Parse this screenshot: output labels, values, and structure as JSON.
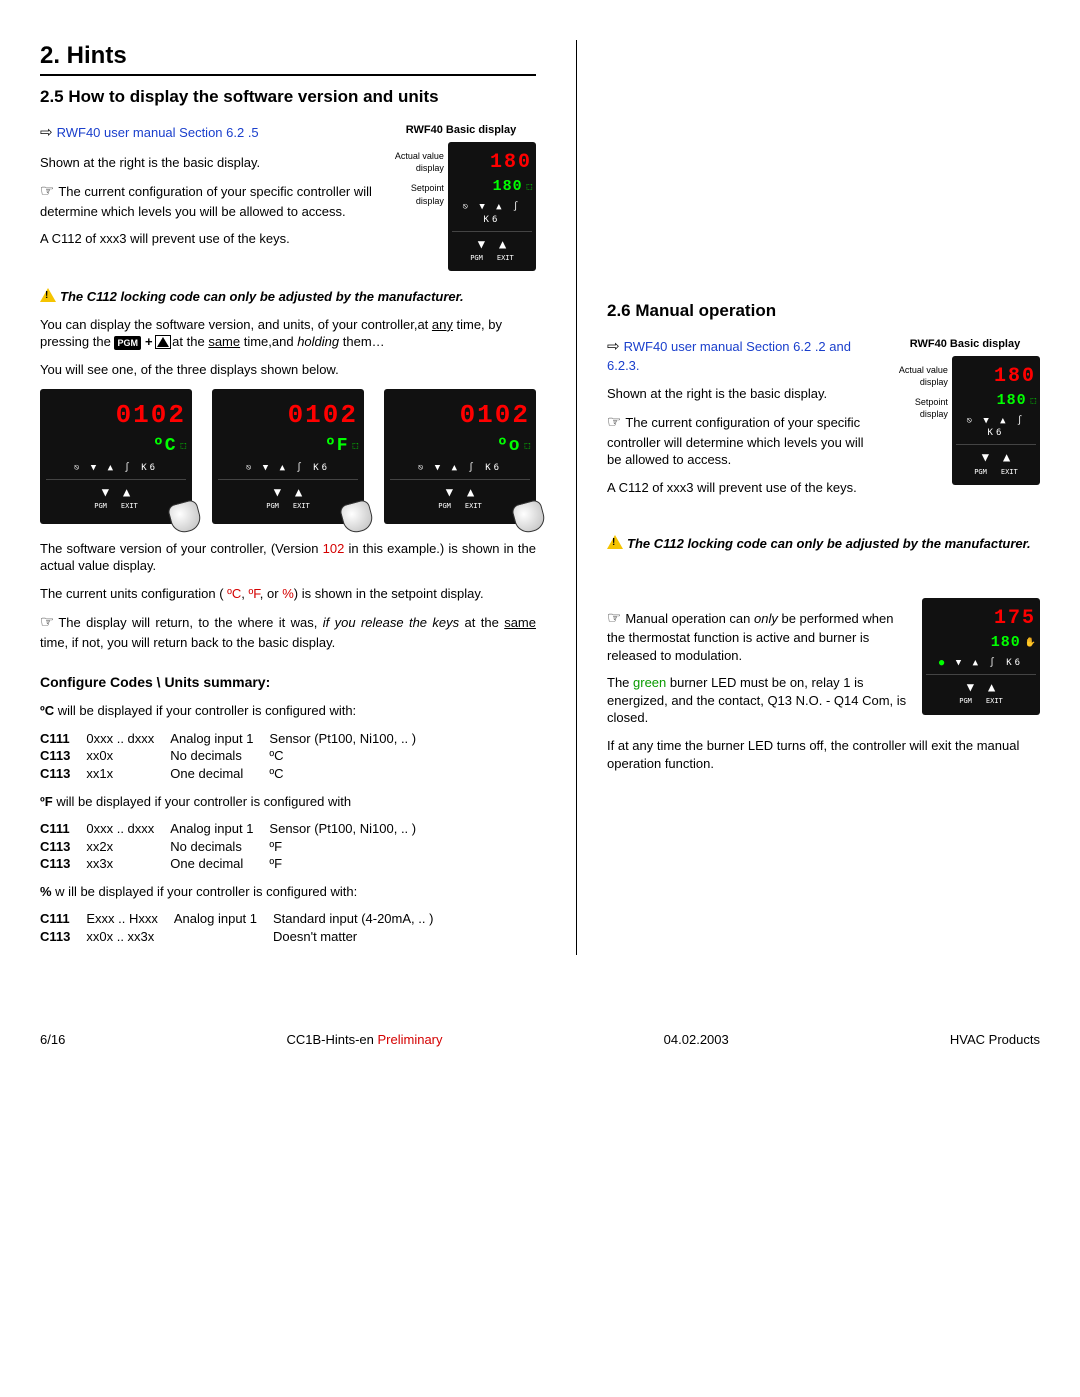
{
  "page": {
    "heading": "2. Hints",
    "section25": "2.5 How to display the software version and units",
    "section26": "2.6 Manual operation",
    "cfg_heading": "Configure Codes \\ Units summary:"
  },
  "links": {
    "s25": "RWF40 user manual Section 6.2 .5",
    "s26": "RWF40 user manual Section 6.2 .2 and 6.2.3."
  },
  "txt": {
    "shown_right": "Shown at the right is the basic display.",
    "config_note_1": "The current configuration of your specific controller will determine which levels you will be allowed to access.",
    "c112_prevent": "A C112 of xxx3 will prevent use of the keys.",
    "c112_lock": "The C112 locking code can only be adjusted  by the manufacturer.",
    "sw_version_pre": "You can display the software version, and units, of your controller,at ",
    "any": "any",
    "sw_version_mid": " time, by pressing the ",
    "sw_version_after": " at the ",
    "same": "same",
    "sw_version_end": " time,and ",
    "holding": "holding",
    "ellipsis": " them…",
    "see_three": "You will see one, of the three displays shown below.",
    "sw_ver_para_a": "The software version of your controller, (Version ",
    "sw_ver_102": "102",
    "sw_ver_para_b": " in this example.) is shown in the actual value display.",
    "units_config_a": "The current units configuration ( ",
    "degC": "ºC",
    "comma1": ", ",
    "degF": "ºF",
    "comma2": ", or ",
    "pct": "%",
    "units_config_b": ") is shown in the setpoint display.",
    "disp_return_a": "The display will return, to the where it was, ",
    "disp_return_it": "if you release the keys",
    "disp_return_b": " at the ",
    "disp_return_c": " time, if not, you will return back to the basic display.",
    "man_only_a": "Manual operation can ",
    "only": "only",
    "man_only_b": " be performed when the thermostat function is active and burner is released to modulation.",
    "green_led_a": "The ",
    "green": "green",
    "green_led_b": " burner LED must be on, relay 1 is energized, and the contact, Q13 N.O. - Q14 Com, is closed.",
    "burner_off": "If at any time the burner LED turns off, the controller will exit the manual operation function."
  },
  "units": {
    "c_intro_a": "ºC",
    "c_intro_b": " will be displayed if your controller is configured with:",
    "f_intro_a": "ºF",
    "f_intro_b": " will be displayed if your controller is configured with",
    "p_intro_a": "%",
    "p_intro_b": " w ill be displayed if your controller is configured with:"
  },
  "tables": {
    "t1": [
      [
        "C111",
        "0xxx .. dxxx",
        "Analog input 1",
        "Sensor (Pt100, Ni100, .. )"
      ],
      [
        "C113",
        "xx0x",
        "No decimals",
        "ºC"
      ],
      [
        "C113",
        "xx1x",
        "One decimal",
        "ºC"
      ]
    ],
    "t2": [
      [
        "C111",
        "0xxx .. dxxx",
        "Analog input 1",
        "Sensor (Pt100, Ni100, .. )"
      ],
      [
        "C113",
        "xx2x",
        "No decimals",
        "ºF"
      ],
      [
        "C113",
        "xx3x",
        "One decimal",
        "ºF"
      ]
    ],
    "t3": [
      [
        "C111",
        "Exxx .. Hxxx",
        "Analog input 1",
        "Standard input (4-20mA, .. )"
      ],
      [
        "C113",
        "xx0x .. xx3x",
        "",
        "Doesn't matter"
      ]
    ]
  },
  "device": {
    "title": "RWF40 Basic display",
    "lab_actual": "Actual value display",
    "lab_setpoint": "Setpoint display",
    "actual_180": "180",
    "setpt_180": "180",
    "icons": "⎋ ▼ ▲ ∫ K6",
    "btn_down": "▼",
    "btn_up": "▲",
    "pgm": "PGM",
    "exit": "EXIT",
    "d1_actual": "0102",
    "d1_set": "ºC",
    "d2_actual": "0102",
    "d2_set": "ºF",
    "d3_actual": "0102",
    "d3_set": "ºo",
    "man_actual": "175",
    "man_set": "180",
    "man_hand": "✋"
  },
  "footer": {
    "page": "6/16",
    "doc_a": "CC1B-Hints-en ",
    "doc_b": "Preliminary",
    "date": "04.02.2003",
    "brand": "HVAC Products"
  }
}
